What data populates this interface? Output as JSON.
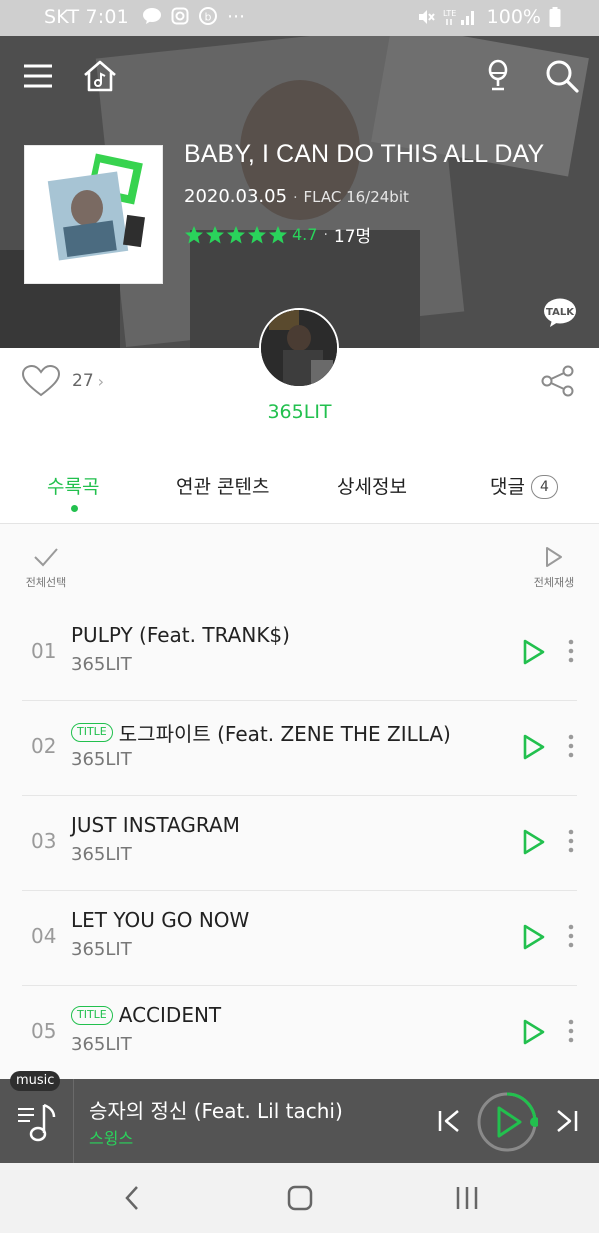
{
  "status_bar": {
    "carrier_time": "SKT 7:01",
    "battery": "100%"
  },
  "album": {
    "title": "BABY, I CAN DO THIS ALL DAY",
    "date": "2020.03.05",
    "format": "FLAC 16/24bit",
    "rating": "4.7",
    "rating_count": "17명",
    "stars": 5
  },
  "talk_label": "TALK",
  "like_count": "27",
  "artist": {
    "name": "365LIT"
  },
  "tabs": [
    {
      "label": "수록곡"
    },
    {
      "label": "연관 콘텐츠"
    },
    {
      "label": "상세정보"
    },
    {
      "label": "댓글"
    }
  ],
  "comment_count": "4",
  "controls": {
    "select_all": "전체선택",
    "play_all": "전체재생"
  },
  "title_badge": "TITLE",
  "tracks": [
    {
      "num": "01",
      "title": "PULPY (Feat. TRANK$)",
      "artist": "365LIT",
      "is_title": false
    },
    {
      "num": "02",
      "title": "도그파이트 (Feat. ZENE THE ZILLA)",
      "artist": "365LIT",
      "is_title": true
    },
    {
      "num": "03",
      "title": "JUST INSTAGRAM",
      "artist": "365LIT",
      "is_title": false
    },
    {
      "num": "04",
      "title": "LET YOU GO NOW",
      "artist": "365LIT",
      "is_title": false
    },
    {
      "num": "05",
      "title": "ACCIDENT",
      "artist": "365LIT",
      "is_title": true
    }
  ],
  "player": {
    "tag": "music",
    "now_playing_title": "승자의 정신 (Feat. Lil tachi)",
    "now_playing_artist": "스윙스",
    "progress": 0.25
  },
  "colors": {
    "accent": "#22c04e",
    "player_bg": "#545454"
  }
}
